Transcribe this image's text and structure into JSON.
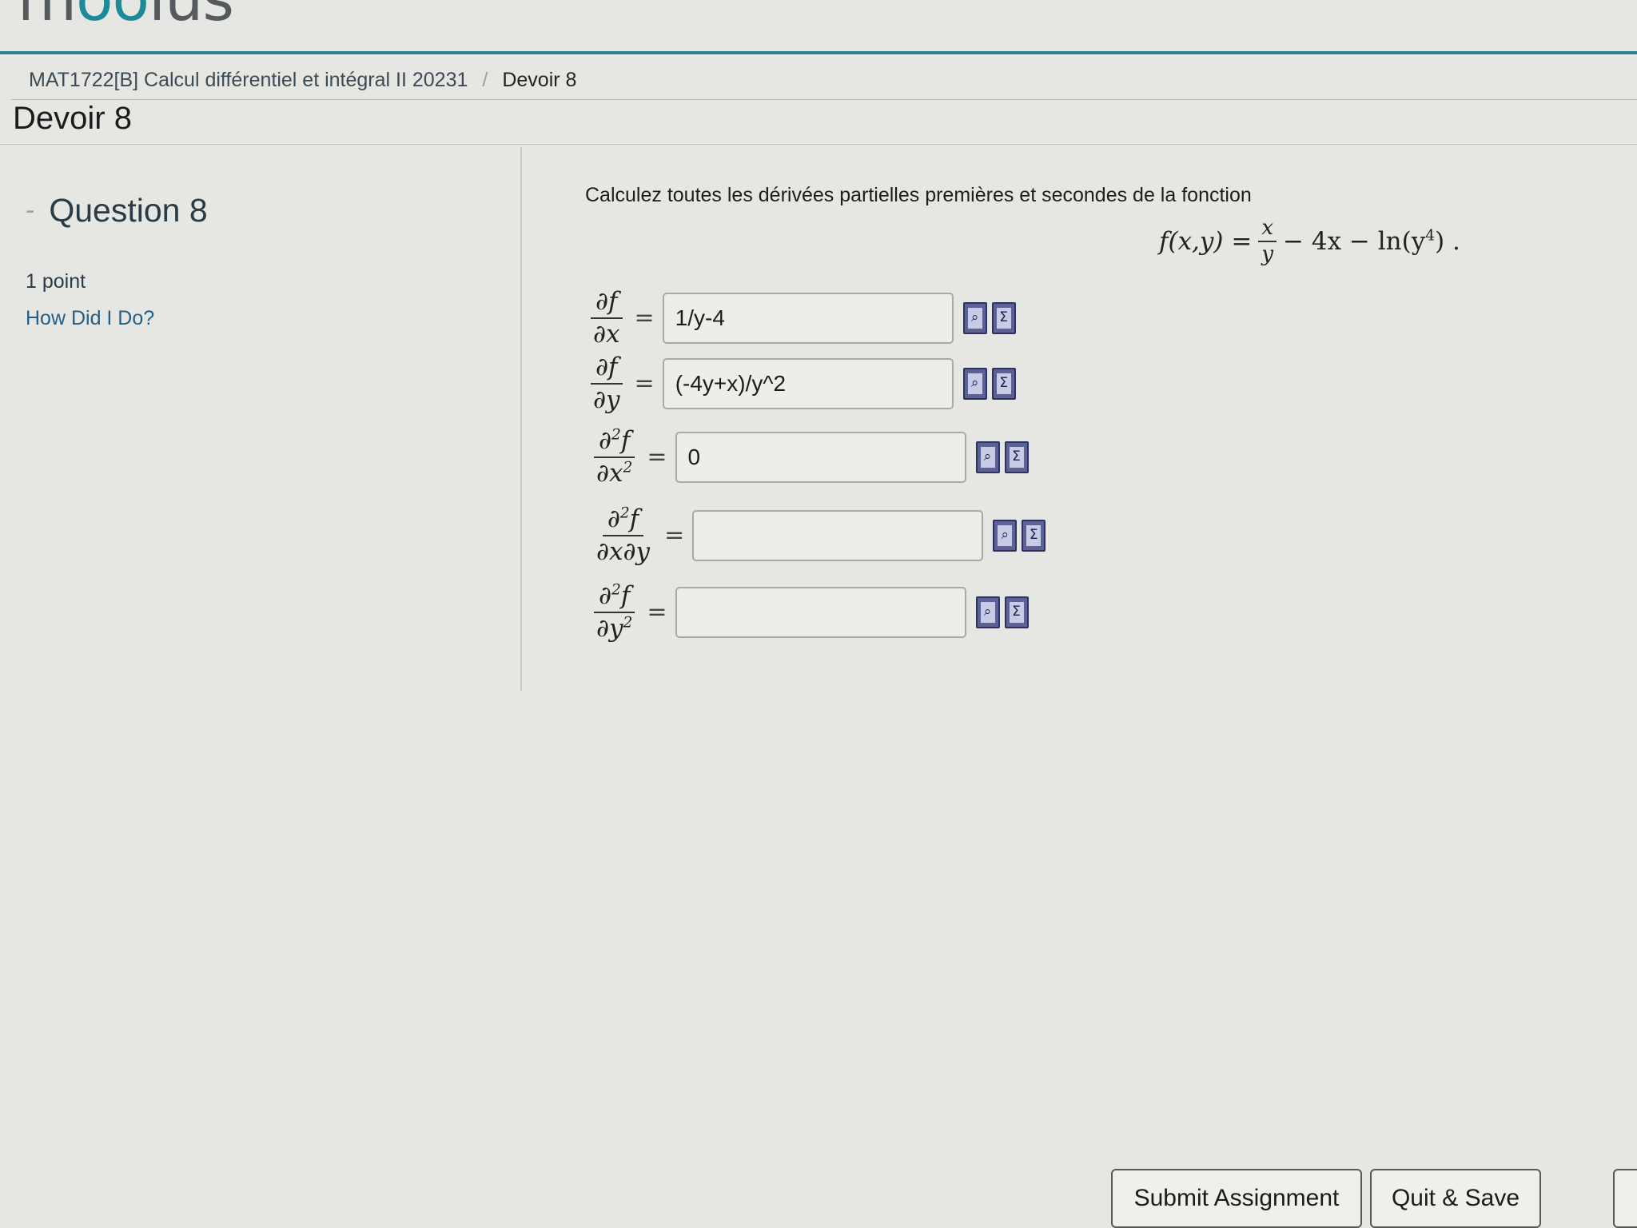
{
  "brand": {
    "logo_text_start": "m",
    "logo_text_oo": "oo",
    "logo_text_end": "ius"
  },
  "breadcrumb": {
    "course": "MAT1722[B] Calcul différentiel et intégral II 20231",
    "separator": "/",
    "current": "Devoir 8"
  },
  "page_title": "Devoir 8",
  "question": {
    "collapse_marker": "-",
    "title": "Question 8",
    "points": "1 point",
    "how_did_i_do": "How Did I Do?",
    "prompt": "Calculez toutes les dérivées partielles premières et secondes de la fonction",
    "function": {
      "lhs": "f(x,y) =",
      "frac_num": "x",
      "frac_den": "y",
      "rest": "− 4x − ln(y",
      "exp": "4",
      "tail": ") ."
    }
  },
  "parts": [
    {
      "num": "∂f",
      "num_exp": "",
      "num_tail": "",
      "den": "∂x",
      "den_exp": "",
      "value": "1/y-4"
    },
    {
      "num": "∂f",
      "num_exp": "",
      "num_tail": "",
      "den": "∂y",
      "den_exp": "",
      "value": "(-4y+x)/y^2"
    },
    {
      "num": "∂",
      "num_exp": "2",
      "num_tail": "f",
      "den": "∂x",
      "den_exp": "2",
      "value": "0"
    },
    {
      "num": "∂",
      "num_exp": "2",
      "num_tail": "f",
      "den": "∂x∂y",
      "den_exp": "",
      "value": ""
    },
    {
      "num": "∂",
      "num_exp": "2",
      "num_tail": "f",
      "den": "∂y",
      "den_exp": "2",
      "value": ""
    }
  ],
  "equals_sign": "=",
  "tool_icons": {
    "preview": "preview-icon",
    "equation_editor": "equation-editor-icon"
  },
  "tool_glyphs": {
    "preview": "⌕",
    "equation_editor": "Σ"
  },
  "buttons": {
    "submit": "Submit Assignment",
    "quit": "Quit & Save"
  },
  "colors": {
    "accent": "#2f7f8c",
    "link": "#1f5f8a",
    "icon": "#5c6293"
  }
}
